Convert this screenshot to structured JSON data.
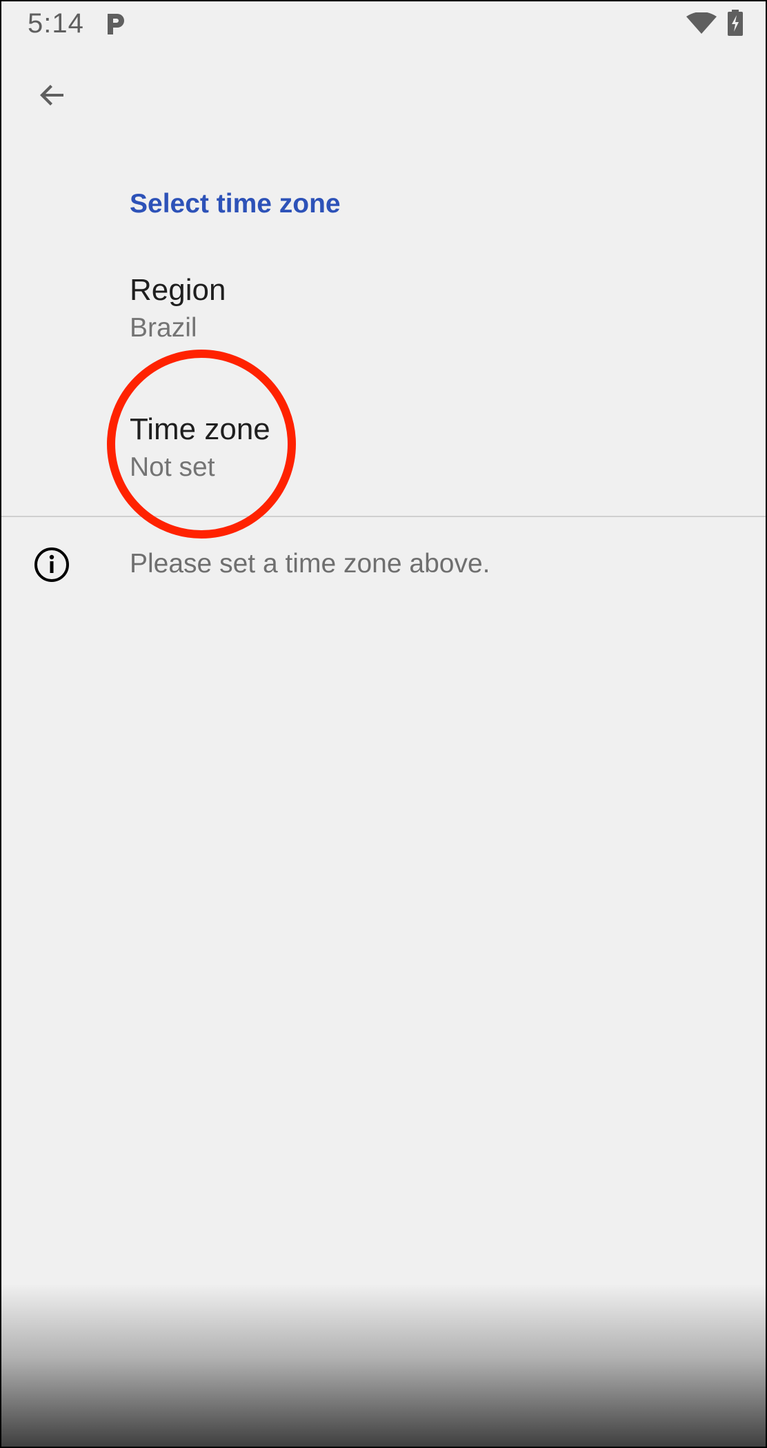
{
  "status_bar": {
    "time": "5:14",
    "notification_icon": "p-notification-icon",
    "wifi_icon": "wifi-icon",
    "battery_icon": "battery-charging-icon"
  },
  "toolbar": {
    "back_icon": "back-arrow-icon"
  },
  "header": {
    "title": "Select time zone",
    "color": "#2d52b8"
  },
  "preferences": [
    {
      "title": "Region",
      "summary": "Brazil"
    },
    {
      "title": "Time zone",
      "summary": "Not set"
    }
  ],
  "footer": {
    "info_icon": "info-icon",
    "text": "Please set a time zone above."
  },
  "annotation": {
    "shape": "circle",
    "color": "#ff2200",
    "target": "Time zone"
  }
}
